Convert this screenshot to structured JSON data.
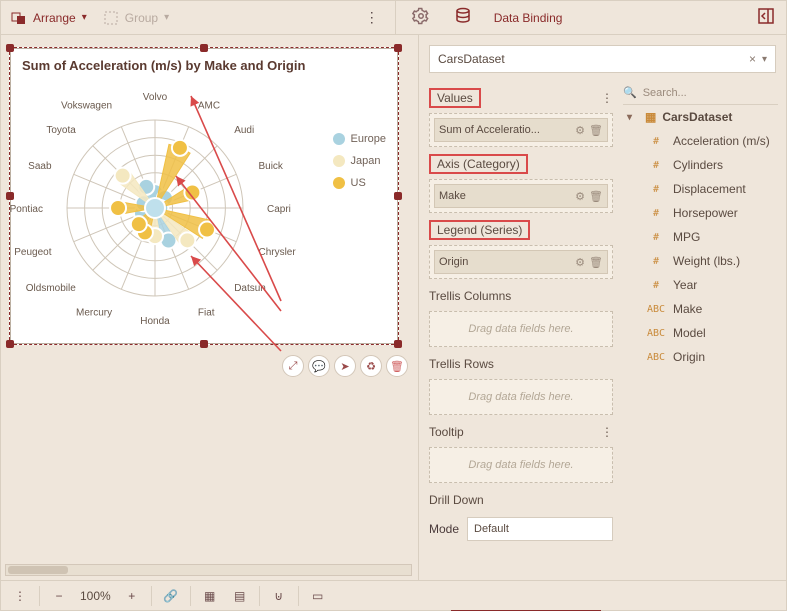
{
  "toolbar": {
    "arrange_label": "Arrange",
    "group_label": "Group",
    "tab_label": "Data Binding"
  },
  "dataset": {
    "name": "CarsDataset",
    "clear": "×"
  },
  "search": {
    "placeholder": "Search..."
  },
  "sections": {
    "values": {
      "label": "Values",
      "chip": "Sum of Acceleratio..."
    },
    "axis": {
      "label": "Axis (Category)",
      "chip": "Make"
    },
    "legend": {
      "label": "Legend (Series)",
      "chip": "Origin"
    },
    "trellisCols": {
      "label": "Trellis Columns",
      "placeholder": "Drag data fields here."
    },
    "trellisRows": {
      "label": "Trellis Rows",
      "placeholder": "Drag data fields here."
    },
    "tooltip": {
      "label": "Tooltip",
      "placeholder": "Drag data fields here."
    },
    "drill": {
      "label": "Drill Down",
      "mode_label": "Mode",
      "mode_value": "Default"
    }
  },
  "fields": {
    "dataset_label": "CarsDataset",
    "items": [
      {
        "type": "#",
        "name": "Acceleration (m/s)"
      },
      {
        "type": "#",
        "name": "Cylinders"
      },
      {
        "type": "#",
        "name": "Displacement"
      },
      {
        "type": "#",
        "name": "Horsepower"
      },
      {
        "type": "#",
        "name": "MPG"
      },
      {
        "type": "#",
        "name": "Weight (lbs.)"
      },
      {
        "type": "#",
        "name": "Year"
      },
      {
        "type": "ABC",
        "name": "Make"
      },
      {
        "type": "ABC",
        "name": "Model"
      },
      {
        "type": "ABC",
        "name": "Origin"
      }
    ]
  },
  "status": {
    "zoom": "100%"
  },
  "chart_data": {
    "type": "radar",
    "title": "Sum of Acceleration (m/s) by Make and Origin",
    "categories": [
      "Volvo",
      "AMC",
      "Audi",
      "Buick",
      "Capri",
      "Chrysler",
      "Datsun",
      "Fiat",
      "Honda",
      "Mercury",
      "Oldsmobile",
      "Peugeot",
      "Pontiac",
      "Saab",
      "Toyota",
      "Vokswagen"
    ],
    "series": [
      {
        "name": "Europe",
        "color": "#a9d2e0",
        "values": {
          "Volvo": 90,
          "Audi": 80,
          "Capri": 30,
          "Fiat": 200,
          "Peugeot": 80,
          "Saab": 70,
          "Vokswagen": 130
        }
      },
      {
        "name": "Japan",
        "color": "#f4e8c0",
        "values": {
          "Datsun": 260,
          "Honda": 160,
          "Toyota": 260
        }
      },
      {
        "name": "US",
        "color": "#f0c044",
        "values": {
          "AMC": 370,
          "Buick": 230,
          "Chrysler": 320,
          "Mercury": 150,
          "Oldsmobile": 130,
          "Pontiac": 210
        }
      }
    ],
    "value_axis": {
      "max": 500,
      "gridlines": 5
    },
    "legend_position": "right"
  }
}
